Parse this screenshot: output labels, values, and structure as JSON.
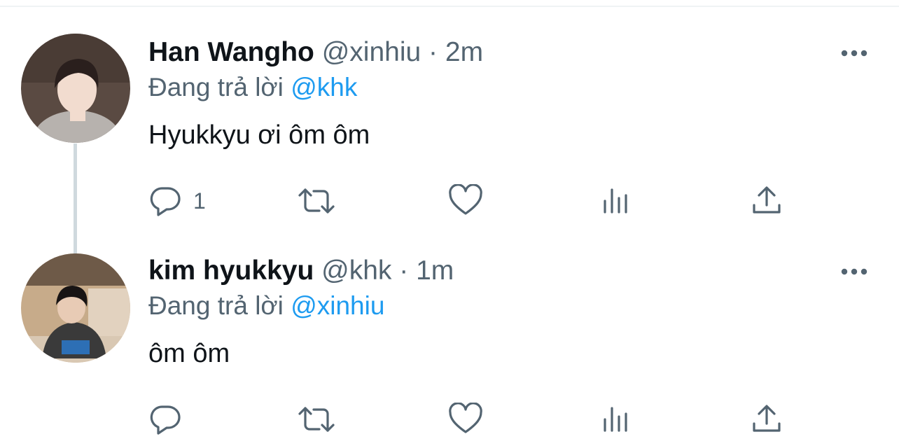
{
  "tweets": [
    {
      "name": "Han Wangho",
      "handle": "@xinhiu",
      "separator": "·",
      "time": "2m",
      "replying_prefix": "Đang trả lời",
      "replying_to": "@khk",
      "text": "Hyukkyu ơi ôm ôm",
      "actions": {
        "reply_count": "1",
        "retweet_count": "",
        "like_count": ""
      },
      "avatar": {
        "bg": "#5a4a42",
        "hair": "#2a1f1d",
        "skin": "#f2dccf",
        "clothes": "#b7b2ae"
      }
    },
    {
      "name": "kim hyukkyu",
      "handle": "@khk",
      "separator": "·",
      "time": "1m",
      "replying_prefix": "Đang trả lời",
      "replying_to": "@xinhiu",
      "text": "ôm ôm",
      "actions": {
        "reply_count": "",
        "retweet_count": "",
        "like_count": ""
      },
      "avatar": {
        "bg": "#c7ab8a",
        "hair": "#181414",
        "skin": "#e8cbb5",
        "clothes": "#3a3a3a"
      }
    }
  ],
  "icons": {
    "more": "more-dots-icon",
    "reply": "reply-icon",
    "retweet": "retweet-icon",
    "like": "heart-icon",
    "analytics": "analytics-icon",
    "share": "share-icon"
  },
  "colors": {
    "text": "#0f1419",
    "secondary": "#536471",
    "accent": "#1d9bf0",
    "thread_line": "#cfd9de"
  }
}
